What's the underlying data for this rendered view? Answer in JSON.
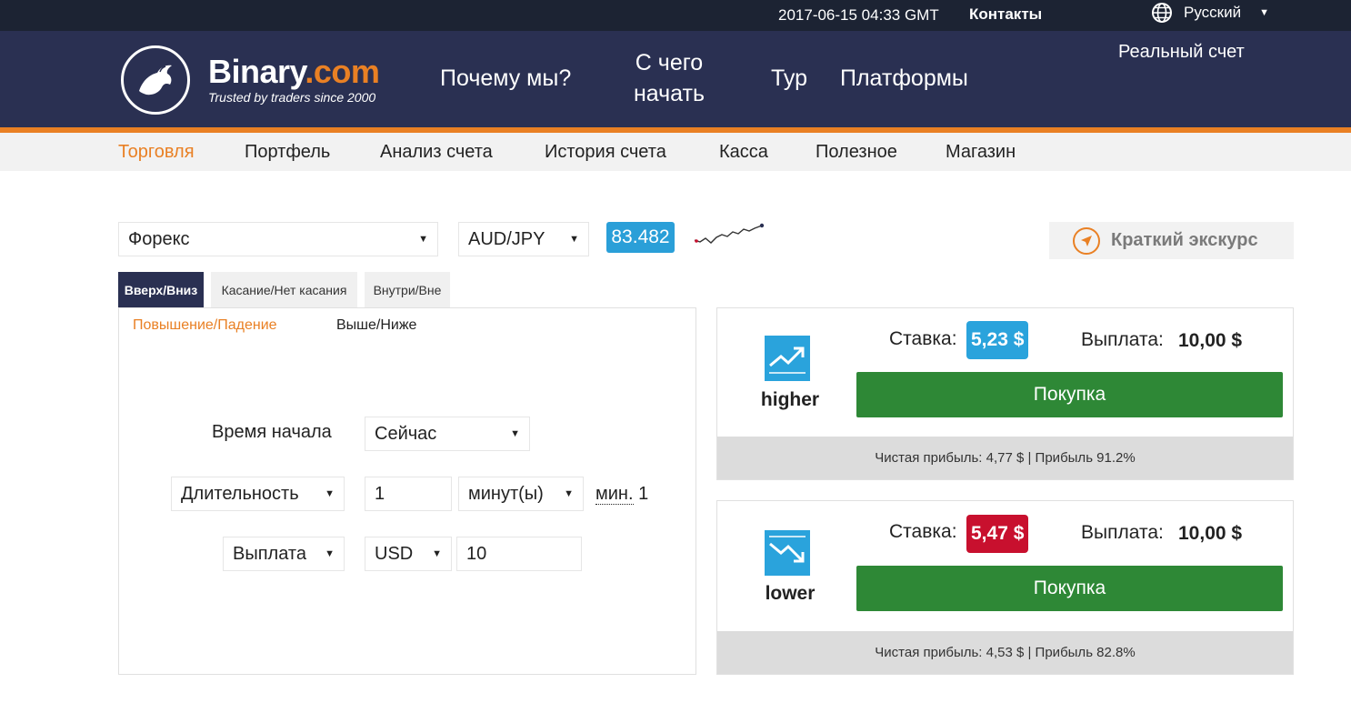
{
  "topbar": {
    "datetime": "2017-06-15 04:33 GMT",
    "contacts": "Контакты",
    "language": "Русский"
  },
  "header": {
    "brand_name": "Binary",
    "brand_suffix": ".com",
    "tagline": "Trusted by traders since 2000",
    "nav": {
      "why_us": "Почему мы?",
      "start_line1": "С чего",
      "start_line2": "начать",
      "tour": "Тур",
      "platforms": "Платформы"
    },
    "account": "Реальный счет"
  },
  "submenu": {
    "items": [
      "Торговля",
      "Портфель",
      "Анализ счета",
      "История счета",
      "Касса",
      "Полезное",
      "Магазин"
    ],
    "active_index": 0
  },
  "market": {
    "market_select": "Форекс",
    "symbol_select": "AUD/JPY",
    "spot_price": "83.482",
    "tour_button": "Краткий экскурс"
  },
  "tabs": [
    "Вверх/Вниз",
    "Касание/Нет касания",
    "Внутри/Вне"
  ],
  "subtabs": [
    "Повышение/Падение",
    "Выше/Ниже"
  ],
  "form": {
    "start_time_label": "Время начала",
    "start_time_value": "Сейчас",
    "duration_select": "Длительность",
    "duration_amount": "1",
    "duration_unit": "минут(ы)",
    "min_label": "мин.",
    "min_value": "1",
    "payout_select": "Выплата",
    "currency": "USD",
    "amount": "10"
  },
  "contracts": {
    "higher": {
      "label": "higher",
      "stake_label": "Ставка:",
      "stake_value": "5,23 $",
      "payout_label": "Выплата:",
      "payout_value": "10,00 $",
      "buy_label": "Покупка",
      "footer": "Чистая прибыль: 4,77 $ | Прибыль 91.2%"
    },
    "lower": {
      "label": "lower",
      "stake_label": "Ставка:",
      "stake_value": "5,47 $",
      "payout_label": "Выплата:",
      "payout_value": "10,00 $",
      "buy_label": "Покупка",
      "footer": "Чистая прибыль: 4,53 $ | Прибыль 82.8%"
    }
  },
  "colors": {
    "header_bg": "#2a3052",
    "accent_orange": "#e98024",
    "price_blue": "#2a9fd8",
    "stake_higher": "#2aa3dc",
    "stake_lower": "#c8102e",
    "buy_green": "#2e8836"
  }
}
